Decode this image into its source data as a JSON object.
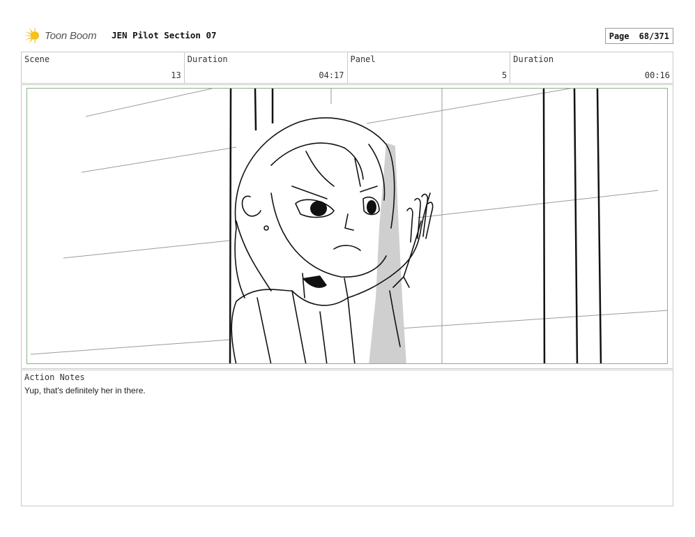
{
  "header": {
    "logo_text": "Toon Boom",
    "document_title": "JEN Pilot Section 07",
    "page_label": "Page",
    "page_value": "68/371"
  },
  "info": {
    "scene_label": "Scene",
    "scene_value": "13",
    "scene_duration_label": "Duration",
    "scene_duration_value": "04:17",
    "panel_label": "Panel",
    "panel_value": "5",
    "panel_duration_label": "Duration",
    "panel_duration_value": "00:16"
  },
  "notes": {
    "title": "Action Notes",
    "text": "Yup, that's definitely her in there."
  },
  "colors": {
    "panel_border": "#86b389",
    "grid_border": "#c8c8c8",
    "logo_yellow": "#f5c21b"
  }
}
